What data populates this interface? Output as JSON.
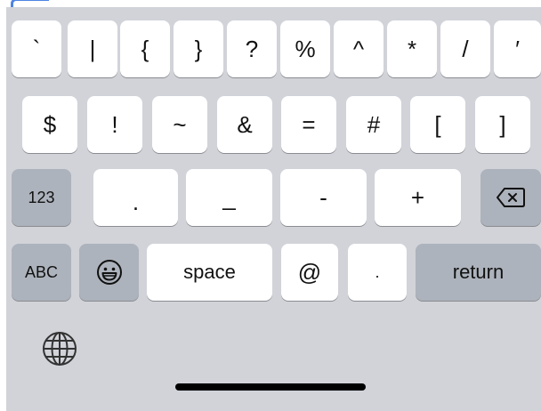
{
  "keyboard": {
    "row1": [
      "`",
      "|",
      "{",
      "}",
      "?",
      "%",
      "^",
      "*",
      "/",
      "′"
    ],
    "row2": [
      "$",
      "!",
      "~",
      "&",
      "=",
      "#",
      "[",
      "]"
    ],
    "row3": {
      "mode_label": "123",
      "keys": [
        ".",
        "_",
        "-",
        "+"
      ]
    },
    "row4": {
      "abc_label": "ABC",
      "space_label": "space",
      "at_label": "@",
      "dot_label": ".",
      "return_label": "return"
    }
  },
  "icons": {
    "delete": "delete-backspace-icon",
    "emoji": "emoji-smiley-icon",
    "globe": "globe-icon"
  },
  "colors": {
    "keyboard_background": "#d1d3d9",
    "letter_key": "#ffffff",
    "function_key": "#adb3bc",
    "key_shadow": "#8a8c91"
  }
}
